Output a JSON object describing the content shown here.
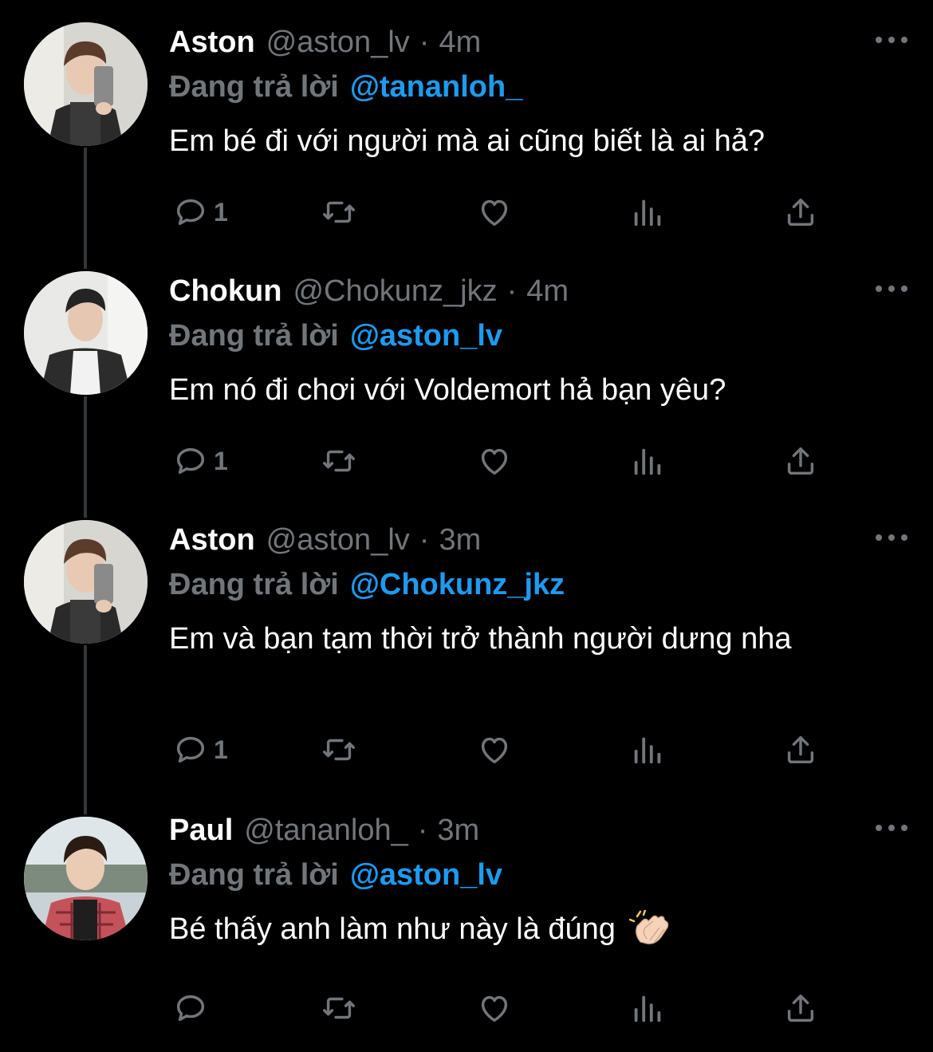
{
  "tweets": [
    {
      "display_name": "Aston",
      "handle": "@aston_lv",
      "separator": "·",
      "time": "4m",
      "reply_prefix": "Đang trả lời",
      "reply_to": "@tananloh_",
      "text": "Em bé đi với người mà ai cũng biết là ai hả?",
      "reply_count": "1"
    },
    {
      "display_name": "Chokun",
      "handle": "@Chokunz_jkz",
      "separator": "·",
      "time": "4m",
      "reply_prefix": "Đang trả lời",
      "reply_to": "@aston_lv",
      "text": "Em nó đi chơi với Voldemort hả bạn yêu?",
      "reply_count": "1"
    },
    {
      "display_name": "Aston",
      "handle": "@aston_lv",
      "separator": "·",
      "time": "3m",
      "reply_prefix": "Đang trả lời",
      "reply_to": "@Chokunz_jkz",
      "text": "Em và bạn tạm thời trở thành người dưng nha",
      "reply_count": "1"
    },
    {
      "display_name": "Paul",
      "handle": "@tananloh_",
      "separator": "·",
      "time": "3m",
      "reply_prefix": "Đang trả lời",
      "reply_to": "@aston_lv",
      "text": "Bé thấy anh làm như này là đúng",
      "reply_count": ""
    }
  ],
  "icons": {
    "reply": "reply-icon",
    "retweet": "retweet-icon",
    "like": "heart-icon",
    "views": "views-icon",
    "share": "share-icon",
    "more": "more-icon",
    "emoji": "clapping-hands-icon"
  },
  "colors": {
    "background": "#000000",
    "text": "#ffffff",
    "muted": "#71767b",
    "link": "#1d9bf0",
    "thread_line": "#333639"
  }
}
